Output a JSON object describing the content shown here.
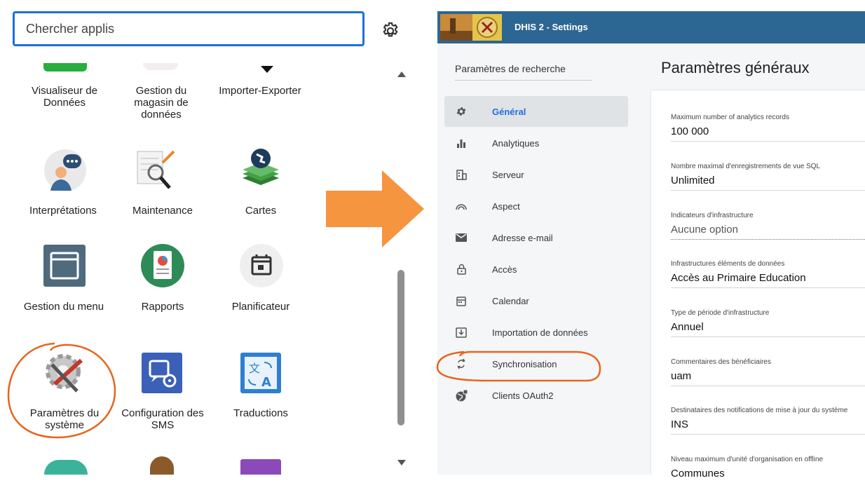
{
  "search": {
    "placeholder": "Chercher applis"
  },
  "apps": [
    {
      "label": "Visualiseur de Données",
      "icon": "data-visualizer-icon"
    },
    {
      "label": "Gestion du magasin de données",
      "icon": "data-store-icon"
    },
    {
      "label": "Importer-Exporter",
      "icon": "import-export-icon"
    },
    {
      "label": "Interprétations",
      "icon": "interpretations-icon"
    },
    {
      "label": "Maintenance",
      "icon": "maintenance-icon"
    },
    {
      "label": "Cartes",
      "icon": "maps-icon"
    },
    {
      "label": "Gestion du menu",
      "icon": "menu-management-icon"
    },
    {
      "label": "Rapports",
      "icon": "reports-icon"
    },
    {
      "label": "Planificateur",
      "icon": "scheduler-icon"
    },
    {
      "label": "Paramètres du système",
      "icon": "system-settings-icon"
    },
    {
      "label": "Configuration des SMS",
      "icon": "sms-configuration-icon"
    },
    {
      "label": "Traductions",
      "icon": "translations-icon"
    }
  ],
  "dhis": {
    "title": "DHIS 2 - Settings",
    "search_label": "Paramètres de recherche",
    "nav": [
      {
        "label": "Général",
        "icon": "gear-icon",
        "active": true
      },
      {
        "label": "Analytiques",
        "icon": "bar-chart-icon"
      },
      {
        "label": "Serveur",
        "icon": "server-icon"
      },
      {
        "label": "Aspect",
        "icon": "appearance-icon"
      },
      {
        "label": "Adresse e-mail",
        "icon": "email-icon"
      },
      {
        "label": "Accès",
        "icon": "lock-icon"
      },
      {
        "label": "Calendar",
        "icon": "calendar-icon"
      },
      {
        "label": "Importation de données",
        "icon": "import-icon"
      },
      {
        "label": "Synchronisation",
        "icon": "sync-icon"
      },
      {
        "label": "Clients OAuth2",
        "icon": "oauth-globe-icon"
      }
    ],
    "main_title": "Paramètres généraux",
    "fields": [
      {
        "label": "Maximum number of analytics records",
        "value": "100 000"
      },
      {
        "label": "Nombre maximal d'enregistrements de vue SQL",
        "value": "Unlimited"
      },
      {
        "label": "Indicateurs d'infrastructure",
        "value": "Aucune option"
      },
      {
        "label": "Infrastructures éléments de données",
        "value": "Accès au Primaire Education"
      },
      {
        "label": "Type de période d'infrastructure",
        "value": "Annuel"
      },
      {
        "label": "Commentaires des bénéficiaires",
        "value": "uam"
      },
      {
        "label": "Destinataires des notifications de mise à jour du système",
        "value": "INS"
      },
      {
        "label": "Niveau maximum d'unité d'organisation en offline",
        "value": "Communes"
      }
    ]
  },
  "colors": {
    "accent": "#1e6fd9",
    "topbar": "#2c6693",
    "arrow": "#f5953f",
    "annotation": "#e8641c"
  }
}
